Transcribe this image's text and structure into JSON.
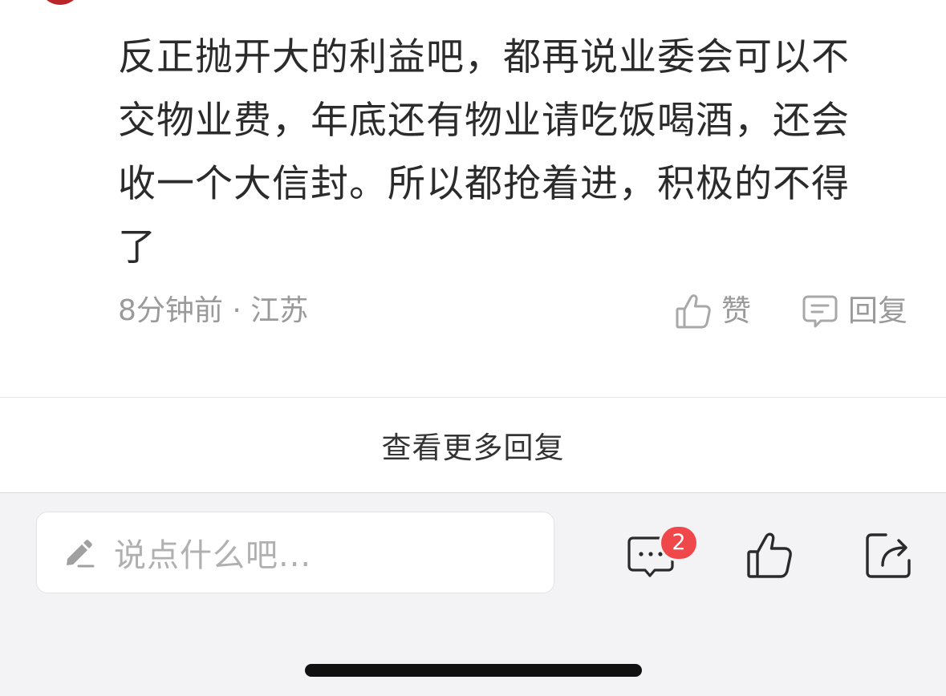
{
  "comment": {
    "text": "反正抛开大的利益吧，都再说业委会可以不交物业费，年底还有物业请吃饭喝酒，还会收一个大信封。所以都抢着进，积极的不得了",
    "meta": "8分钟前 · 江苏",
    "like_label": "赞",
    "reply_label": "回复"
  },
  "more_replies_label": "查看更多回复",
  "bottom_bar": {
    "input_placeholder": "说点什么吧...",
    "comment_count": "2"
  },
  "icons": {
    "avatar_color": "#b8262a",
    "badge_color": "#f0484a",
    "names": [
      "thumbs-up-icon",
      "comment-bubble-icon",
      "pencil-icon",
      "comments-icon",
      "share-icon"
    ]
  }
}
